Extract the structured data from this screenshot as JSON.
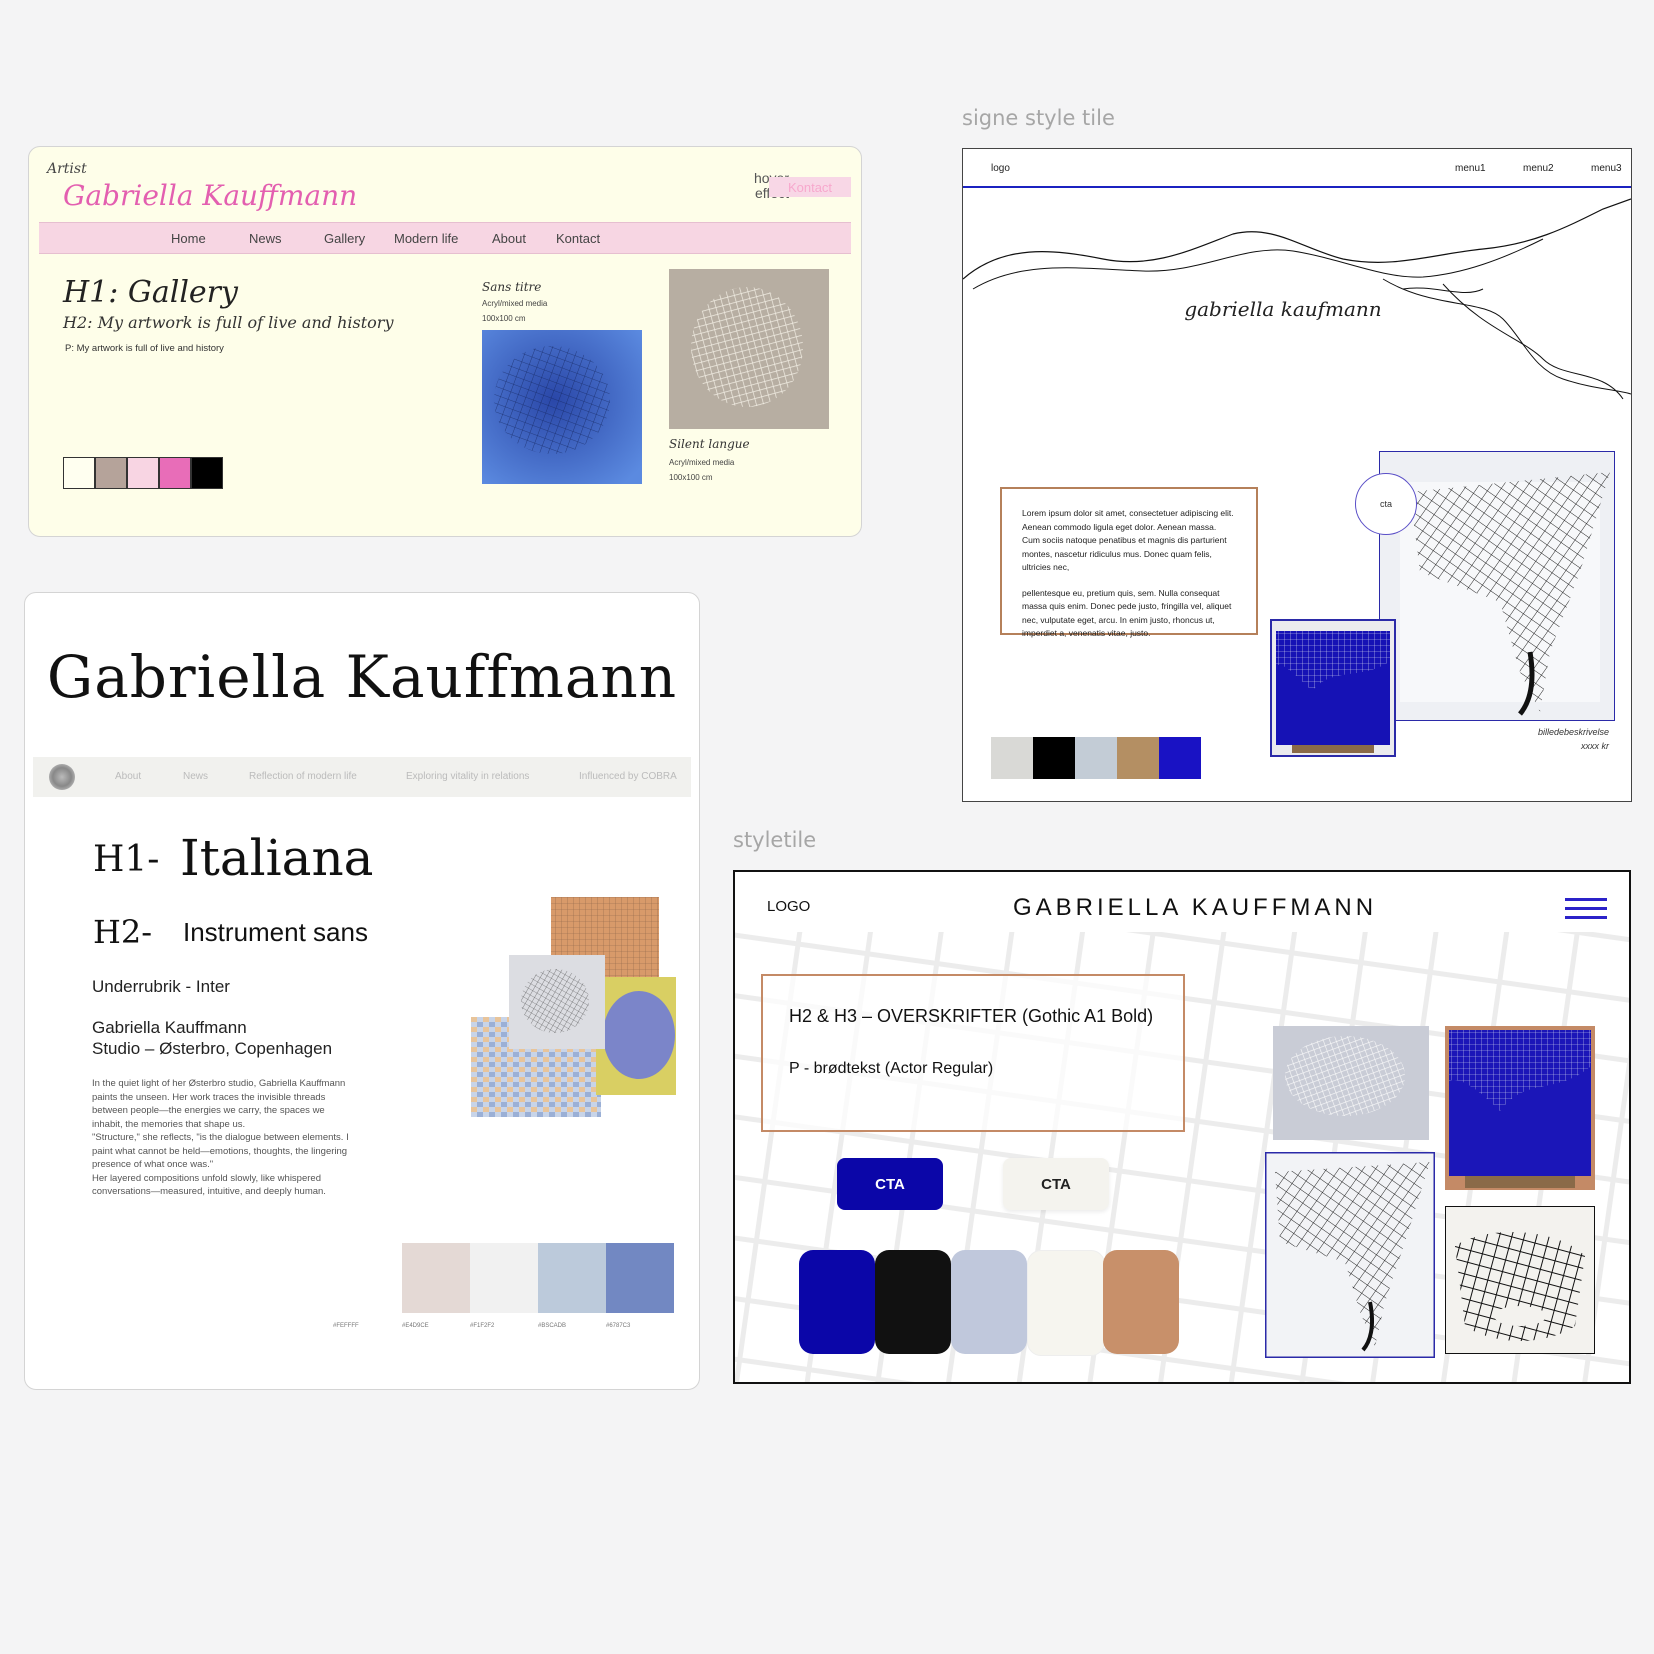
{
  "labels": {
    "signe": "signe style tile",
    "styletile": "styletile"
  },
  "gallery_tile": {
    "artist_tag": "Artist",
    "brand_name": "Gabriella Kauffmann",
    "hover_label": "hover effect",
    "kontakt_button": "Kontact",
    "nav": [
      "Home",
      "News",
      "Gallery",
      "Modern life",
      "About",
      "Kontact"
    ],
    "h1": "H1: Gallery",
    "h2": "H2: My artwork is full of live and history",
    "p": "P: My artwork is full of live and history",
    "swatches": [
      "#fffff0",
      "#b5a39a",
      "#f8d5e3",
      "#e86db8",
      "#000000"
    ],
    "artworks": [
      {
        "title": "Sans titre",
        "medium": "Acryl/mixed media",
        "size": "100x100 cm"
      },
      {
        "title": "Silent langue",
        "medium": "Acryl/mixed media",
        "size": "100x100 cm"
      }
    ]
  },
  "italiana_tile": {
    "name": "Gabriella Kauffmann",
    "nav": [
      "About",
      "News",
      "Reflection of modern life",
      "Exploring vitality in relations",
      "Influenced by COBRA"
    ],
    "h1_label": "H1-",
    "h1_font": "Italiana",
    "h2_label": "H2-",
    "h2_font": "Instrument sans",
    "subheading": "Underrubrik -  Inter",
    "person_name": "Gabriella Kauffmann",
    "studio": "Studio – Østerbro, Copenhagen",
    "bio": [
      "In the quiet light of her Østerbro studio, Gabriella Kauffmann",
      "paints the unseen. Her work traces the invisible threads",
      "between people—the energies we carry, the spaces we",
      "inhabit, the memories that shape us.",
      "\"Structure,\" she reflects, \"is the dialogue between elements. I",
      "paint what cannot be held—emotions, thoughts, the lingering",
      "presence of what once was.\"",
      "Her layered compositions unfold slowly, like whispered",
      "conversations—measured, intuitive, and deeply human."
    ],
    "swatches": [
      {
        "color": "#e4d9d5"
      },
      {
        "color": "#f1f1f1"
      },
      {
        "color": "#bccadb"
      },
      {
        "color": "#7288c2"
      }
    ],
    "hex_labels": [
      "#FEFFFF",
      "#E4D9CE",
      "#F1F2F2",
      "#BSCADB",
      "#6787C3"
    ]
  },
  "signe_tile": {
    "logo": "logo",
    "menu": [
      "menu1",
      "menu2",
      "menu3"
    ],
    "title": "gabriella kaufmann",
    "body_1": "Lorem ipsum dolor sit amet, consectetuer adipiscing elit. Aenean commodo ligula eget dolor. Aenean massa. Cum sociis natoque penatibus et magnis dis parturient montes, nascetur ridiculus mus. Donec quam felis, ultricies nec,",
    "body_2": "pellentesque eu, pretium quis, sem. Nulla consequat massa quis enim. Donec pede justo, fringilla vel, aliquet nec, vulputate eget, arcu. In enim justo, rhoncus ut, imperdiet a, venenatis vitae, justo.",
    "cta": "cta",
    "caption_1": "billedebeskrivelse",
    "caption_2": "xxxx kr",
    "swatches": [
      "#d9d9d6",
      "#000000",
      "#c3ccd6",
      "#b48f63",
      "#1912c4"
    ]
  },
  "styletile": {
    "logo": "LOGO",
    "title": "GABRIELLA  KAUFFMANN",
    "heading_sample": "H2 & H3 – OVERSKRIFTER (Gothic A1 Bold)",
    "body_sample": "P - brødtekst (Actor Regular)",
    "cta_primary": "CTA",
    "cta_secondary": "CTA",
    "accent": "#0b06a8",
    "swatches": [
      "#0b06a8",
      "#111111",
      "#c0c8dc",
      "#f6f5ef",
      "#c8906a"
    ]
  }
}
